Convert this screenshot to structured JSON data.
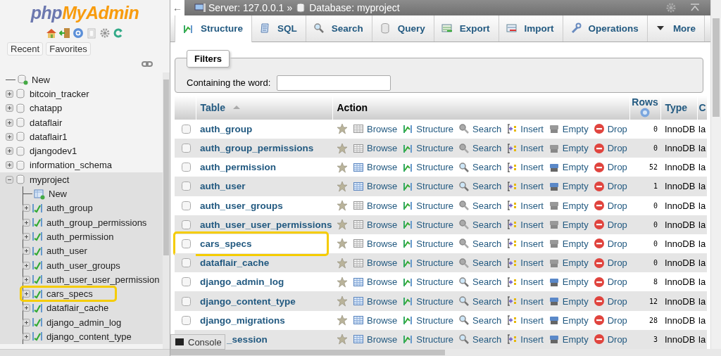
{
  "logo": {
    "part_1": "php",
    "part_2": "MyAdmin"
  },
  "nav_buttons": [
    "Recent",
    "Favorites"
  ],
  "tree": [
    {
      "label": "New",
      "kind": "new"
    },
    {
      "label": "bitcoin_tracker",
      "kind": "db",
      "expanded": false
    },
    {
      "label": "chatapp",
      "kind": "db",
      "expanded": false
    },
    {
      "label": "dataflair",
      "kind": "db",
      "expanded": false
    },
    {
      "label": "dataflair1",
      "kind": "db",
      "expanded": false
    },
    {
      "label": "djangodev1",
      "kind": "db",
      "expanded": false
    },
    {
      "label": "information_schema",
      "kind": "db",
      "expanded": false
    },
    {
      "label": "myproject",
      "kind": "db",
      "expanded": true,
      "children": [
        {
          "label": "New",
          "kind": "new-table"
        },
        {
          "label": "auth_group",
          "kind": "table",
          "expanded": false,
          "highlighted": false
        },
        {
          "label": "auth_group_permissions",
          "kind": "table",
          "expanded": false,
          "highlighted": false
        },
        {
          "label": "auth_permission",
          "kind": "table",
          "expanded": false,
          "highlighted": false
        },
        {
          "label": "auth_user",
          "kind": "table",
          "expanded": false,
          "highlighted": false
        },
        {
          "label": "auth_user_groups",
          "kind": "table",
          "expanded": false,
          "highlighted": false
        },
        {
          "label": "auth_user_user_permission",
          "kind": "table",
          "expanded": false,
          "highlighted": false
        },
        {
          "label": "cars_specs",
          "kind": "table",
          "expanded": false,
          "highlighted": true
        },
        {
          "label": "dataflair_cache",
          "kind": "table",
          "expanded": false,
          "highlighted": false
        },
        {
          "label": "django_admin_log",
          "kind": "table",
          "expanded": false,
          "highlighted": false
        },
        {
          "label": "django_content_type",
          "kind": "table",
          "expanded": false,
          "highlighted": false
        }
      ]
    }
  ],
  "breadcrumb": {
    "back": "←",
    "server": "Server: 127.0.0.1",
    "separator": "»",
    "database": "Database: myproject"
  },
  "tabs": [
    {
      "label": "Structure",
      "kind": "structure",
      "selected": true
    },
    {
      "label": "SQL",
      "kind": "sql",
      "selected": false
    },
    {
      "label": "Search",
      "kind": "search",
      "selected": false
    },
    {
      "label": "Query",
      "kind": "query",
      "selected": false
    },
    {
      "label": "Export",
      "kind": "export",
      "selected": false
    },
    {
      "label": "Import",
      "kind": "import",
      "selected": false
    },
    {
      "label": "Operations",
      "kind": "operations",
      "selected": false
    },
    {
      "label": "More",
      "kind": "more",
      "selected": false
    }
  ],
  "filters": {
    "legend": "Filters",
    "label": "Containing the word:"
  },
  "table": {
    "columns": [
      "Table",
      "Action",
      "Rows",
      "Type",
      "C"
    ],
    "rows": [
      {
        "name": "auth_group",
        "empty": true,
        "highlighted": false,
        "covered": false,
        "actions": [
          "Browse",
          "Structure",
          "Search",
          "Insert",
          "Empty",
          "Drop"
        ],
        "rows": "0",
        "type": "InnoDB",
        "column_5": "la"
      },
      {
        "name": "auth_group_permissions",
        "empty": true,
        "highlighted": false,
        "covered": false,
        "actions": [
          "Browse",
          "Structure",
          "Search",
          "Insert",
          "Empty",
          "Drop"
        ],
        "rows": "0",
        "type": "InnoDB",
        "column_5": "la"
      },
      {
        "name": "auth_permission",
        "empty": false,
        "highlighted": false,
        "covered": false,
        "actions": [
          "Browse",
          "Structure",
          "Search",
          "Insert",
          "Empty",
          "Drop"
        ],
        "rows": "52",
        "type": "InnoDB",
        "column_5": "la"
      },
      {
        "name": "auth_user",
        "empty": false,
        "highlighted": false,
        "covered": false,
        "actions": [
          "Browse",
          "Structure",
          "Search",
          "Insert",
          "Empty",
          "Drop"
        ],
        "rows": "1",
        "type": "InnoDB",
        "column_5": "la"
      },
      {
        "name": "auth_user_groups",
        "empty": true,
        "highlighted": false,
        "covered": false,
        "actions": [
          "Browse",
          "Structure",
          "Search",
          "Insert",
          "Empty",
          "Drop"
        ],
        "rows": "0",
        "type": "InnoDB",
        "column_5": "la"
      },
      {
        "name": "auth_user_user_permissions",
        "empty": true,
        "highlighted": false,
        "covered": false,
        "actions": [
          "Browse",
          "Structure",
          "Search",
          "Insert",
          "Empty",
          "Drop"
        ],
        "rows": "0",
        "type": "InnoDB",
        "column_5": "la"
      },
      {
        "name": "cars_specs",
        "empty": true,
        "highlighted": true,
        "covered": false,
        "actions": [
          "Browse",
          "Structure",
          "Search",
          "Insert",
          "Empty",
          "Drop"
        ],
        "rows": "0",
        "type": "InnoDB",
        "column_5": "la"
      },
      {
        "name": "dataflair_cache",
        "empty": true,
        "highlighted": false,
        "covered": false,
        "actions": [
          "Browse",
          "Structure",
          "Search",
          "Insert",
          "Empty",
          "Drop"
        ],
        "rows": "0",
        "type": "InnoDB",
        "column_5": "la"
      },
      {
        "name": "django_admin_log",
        "empty": false,
        "highlighted": false,
        "covered": false,
        "actions": [
          "Browse",
          "Structure",
          "Search",
          "Insert",
          "Empty",
          "Drop"
        ],
        "rows": "8",
        "type": "InnoDB",
        "column_5": "la"
      },
      {
        "name": "django_content_type",
        "empty": false,
        "highlighted": false,
        "covered": false,
        "actions": [
          "Browse",
          "Structure",
          "Search",
          "Insert",
          "Empty",
          "Drop"
        ],
        "rows": "12",
        "type": "InnoDB",
        "column_5": "la"
      },
      {
        "name": "django_migrations",
        "empty": false,
        "highlighted": false,
        "covered": false,
        "actions": [
          "Browse",
          "Structure",
          "Search",
          "Insert",
          "Empty",
          "Drop"
        ],
        "rows": "28",
        "type": "InnoDB",
        "column_5": "la"
      },
      {
        "name": "_session",
        "empty": false,
        "highlighted": false,
        "covered": true,
        "actions": [
          "Browse",
          "Structure",
          "Search",
          "Insert",
          "Empty",
          "Drop"
        ],
        "rows": "3",
        "type": "InnoDB",
        "column_5": "la"
      }
    ]
  },
  "console": "Console"
}
